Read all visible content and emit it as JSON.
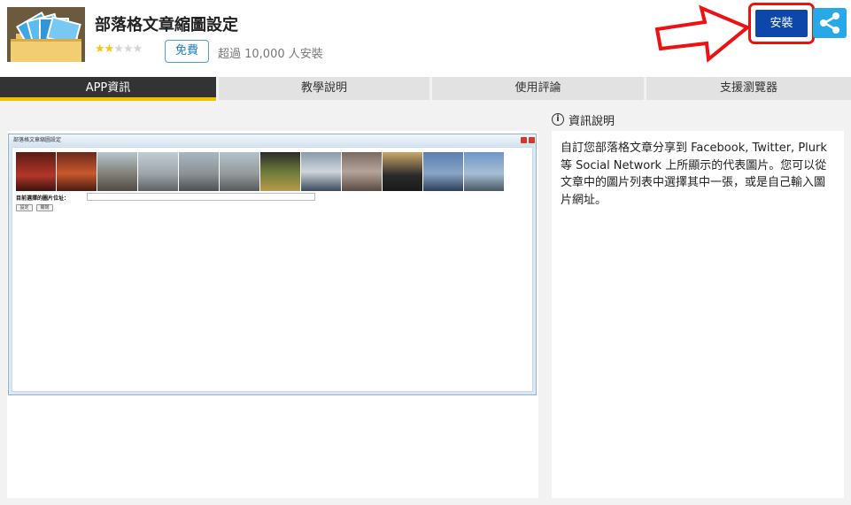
{
  "app": {
    "title": "部落格文章縮圖設定",
    "rating_stars": 2,
    "rating_max": 5,
    "price": "免費",
    "installs": "超過 10,000 人安裝",
    "install_label": "安裝",
    "share_icon": "share-icon",
    "icon": "photo-folder-icon"
  },
  "colors": {
    "install_button": "#0d47a9",
    "share_button": "#27a9e8",
    "highlight_frame": "#ee1111",
    "active_tab": "#333333",
    "active_tab_underline": "#f0c000"
  },
  "tabs": [
    {
      "label": "APP資訊",
      "active": true
    },
    {
      "label": "教學說明",
      "active": false
    },
    {
      "label": "使用評論",
      "active": false
    },
    {
      "label": "支援瀏覽器",
      "active": false
    }
  ],
  "screenshot": {
    "window_title": "部落格文章縮圖設定",
    "field_label": "目前選擇的圖片位址：",
    "buttons": [
      "設定",
      "關閉"
    ]
  },
  "info": {
    "heading": "資訊說明",
    "description": "自訂您部落格文章分享到 Facebook, Twitter, Plurk 等 Social Network 上所顯示的代表圖片。您可以從文章中的圖片列表中選擇其中一張，或是自己輸入圖片網址。"
  }
}
